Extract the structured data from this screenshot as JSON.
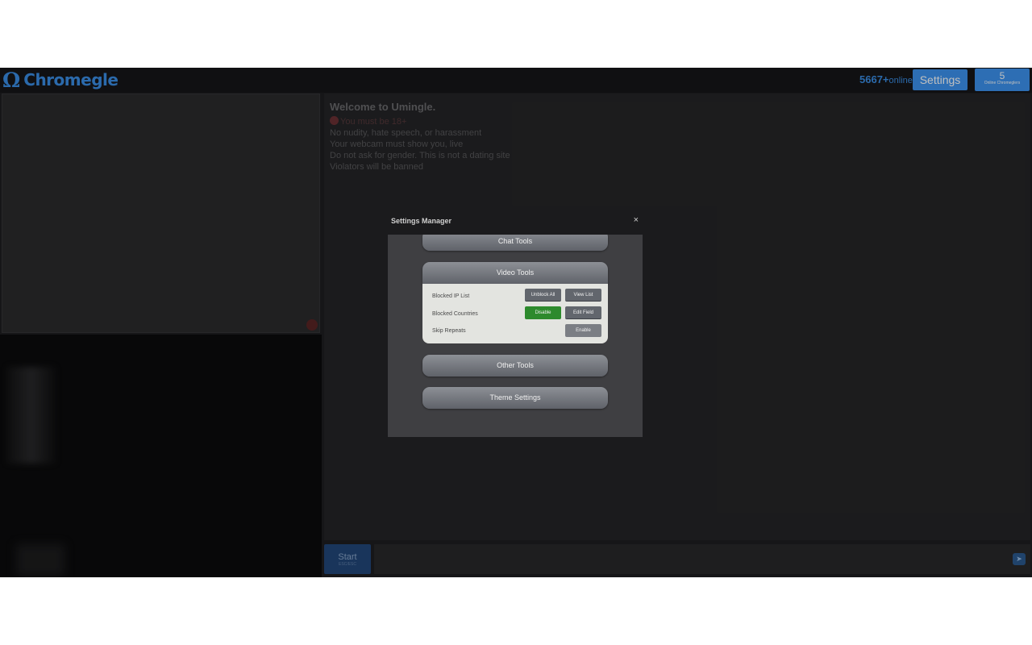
{
  "header": {
    "logo_symbol": "Ω",
    "logo_text": "Chromegle",
    "online_count": "5667+",
    "online_label": "online",
    "settings_label": "Settings",
    "chromeglers_count": "5",
    "chromeglers_label": "Online Chromeglers"
  },
  "welcome": {
    "title": "Welcome to Umingle.",
    "rules": [
      "You must be 18+",
      "No nudity, hate speech, or harassment",
      "Your webcam must show you, live",
      "Do not ask for gender. This is not a dating site",
      "Violators will be banned"
    ]
  },
  "bottom": {
    "start_label": "Start",
    "start_sub": "ESC/ESC",
    "chat_placeholder": "",
    "send_icon": "➤"
  },
  "modal": {
    "title": "Settings Manager",
    "close": "×",
    "sections": {
      "chat": "Chat Tools",
      "video": "Video Tools",
      "other": "Other Tools",
      "theme": "Theme Settings"
    },
    "video_options": {
      "blocked_ip_label": "Blocked IP List",
      "unblock_all": "Unblock All",
      "view_list": "View List",
      "blocked_countries_label": "Blocked Countries",
      "disable": "Disable",
      "edit_field": "Edit Field",
      "skip_repeats_label": "Skip Repeats",
      "enable": "Enable"
    }
  },
  "colors": {
    "accent": "#3c93f0",
    "disable_green": "#2d8a2d",
    "background": "#1e1e20"
  }
}
